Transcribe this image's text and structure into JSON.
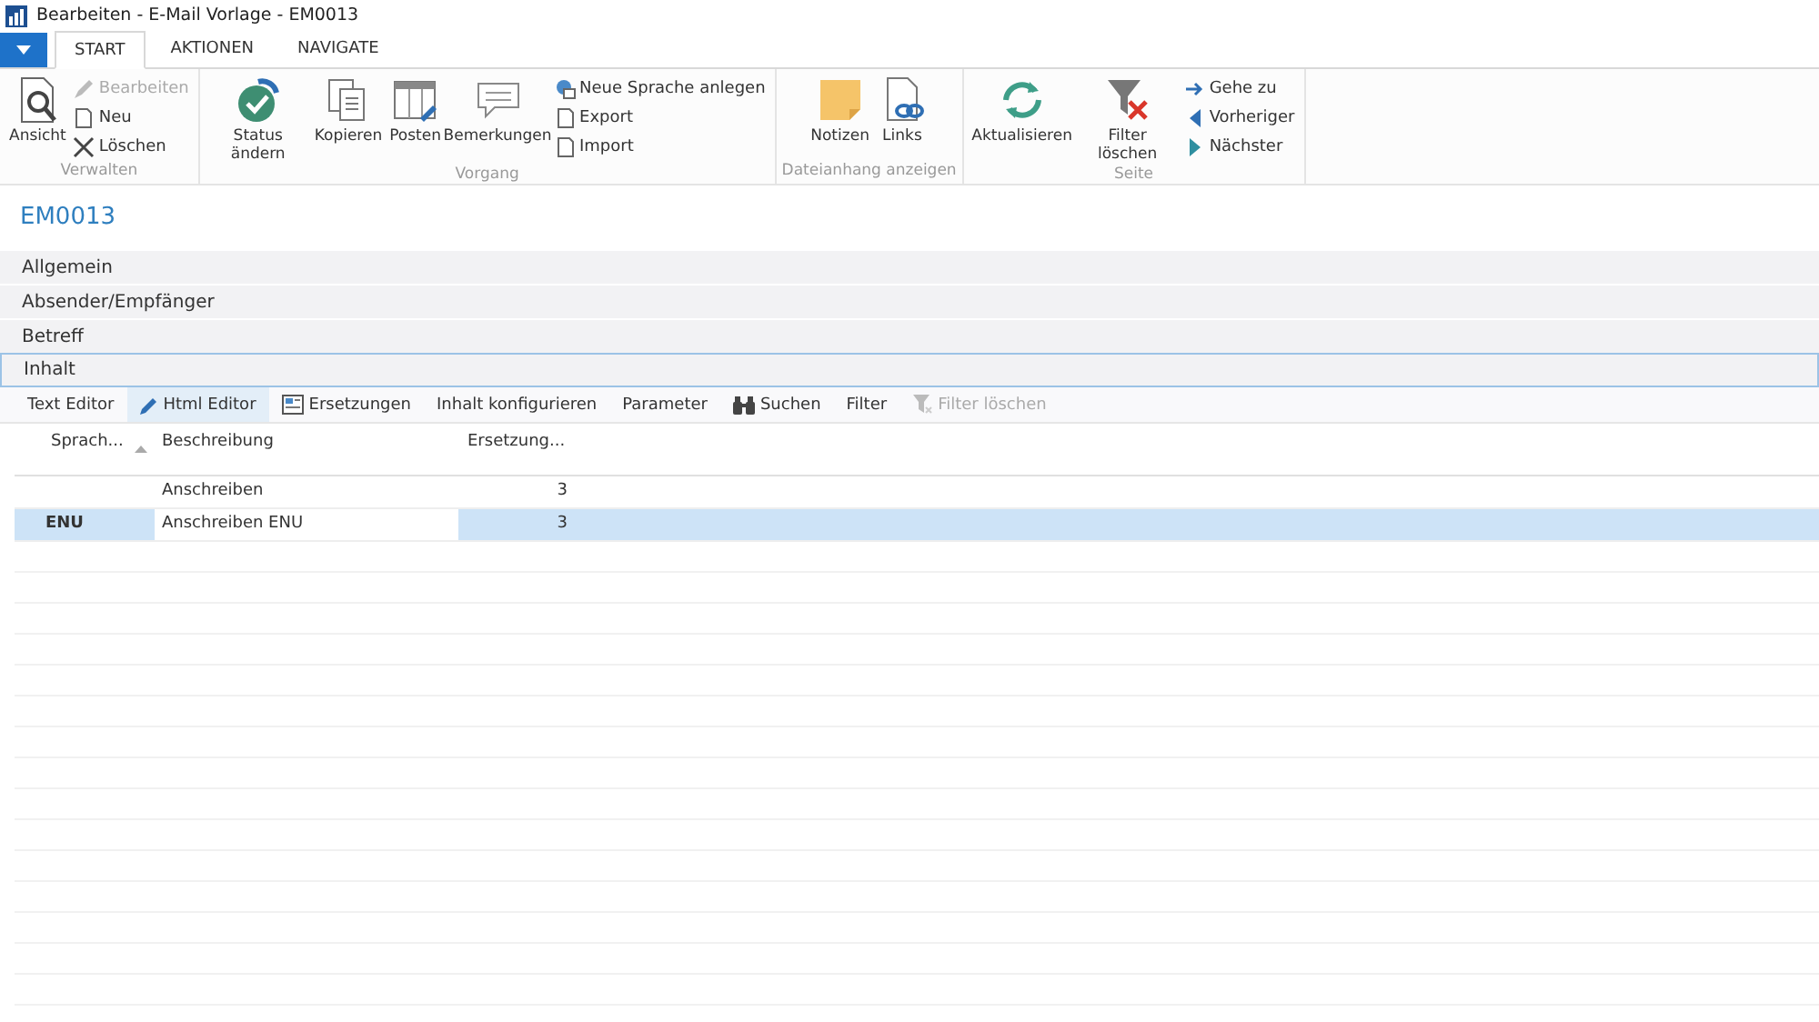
{
  "window": {
    "title": "Bearbeiten - E-Mail Vorlage - EM0013"
  },
  "tabs": [
    {
      "label": "START",
      "selected": true
    },
    {
      "label": "AKTIONEN",
      "selected": false
    },
    {
      "label": "NAVIGATE",
      "selected": false
    }
  ],
  "ribbon": [
    {
      "label": "Verwalten",
      "large": [
        {
          "label": "Ansicht"
        }
      ],
      "small": [
        {
          "label": "Bearbeiten",
          "disabled": true
        },
        {
          "label": "Neu",
          "disabled": false
        },
        {
          "label": "Löschen",
          "disabled": false
        }
      ]
    },
    {
      "label": "Vorgang",
      "large": [
        {
          "label": "Status ändern"
        },
        {
          "label": "Kopieren"
        },
        {
          "label": "Posten"
        },
        {
          "label": "Bemerkungen"
        }
      ],
      "small": [
        {
          "label": "Neue Sprache anlegen",
          "disabled": false
        },
        {
          "label": "Export",
          "disabled": false
        },
        {
          "label": "Import",
          "disabled": false
        }
      ]
    },
    {
      "label": "Dateianhang anzeigen",
      "large": [
        {
          "label": "Notizen"
        },
        {
          "label": "Links"
        }
      ]
    },
    {
      "label": "Seite",
      "large": [
        {
          "label": "Aktualisieren"
        },
        {
          "label": "Filter löschen"
        }
      ],
      "small": [
        {
          "label": "Gehe zu",
          "disabled": false
        },
        {
          "label": "Vorheriger",
          "disabled": false
        },
        {
          "label": "Nächster",
          "disabled": false
        }
      ]
    }
  ],
  "page_title": "EM0013",
  "fasttabs": [
    {
      "label": "Allgemein",
      "selected": false
    },
    {
      "label": "Absender/Empfänger",
      "selected": false
    },
    {
      "label": "Betreff",
      "selected": false
    },
    {
      "label": "Inhalt",
      "selected": true
    }
  ],
  "toolbar": [
    {
      "label": "Text Editor",
      "disabled": false,
      "selected": false
    },
    {
      "label": "Html Editor",
      "disabled": false,
      "selected": true
    },
    {
      "label": "Ersetzungen",
      "disabled": false,
      "selected": false
    },
    {
      "label": "Inhalt konfigurieren",
      "disabled": false,
      "selected": false
    },
    {
      "label": "Parameter",
      "disabled": false,
      "selected": false
    },
    {
      "label": "Suchen",
      "disabled": false,
      "selected": false
    },
    {
      "label": "Filter",
      "disabled": false,
      "selected": false
    },
    {
      "label": "Filter löschen",
      "disabled": true,
      "selected": false
    }
  ],
  "table": {
    "columns": [
      "Sprach...",
      "Beschreibung",
      "Ersetzung..."
    ],
    "rows": [
      {
        "cells": [
          "",
          "Anschreiben",
          "3"
        ],
        "selected": false
      },
      {
        "cells": [
          "ENU",
          "Anschreiben ENU",
          "3"
        ],
        "selected": true
      }
    ]
  }
}
